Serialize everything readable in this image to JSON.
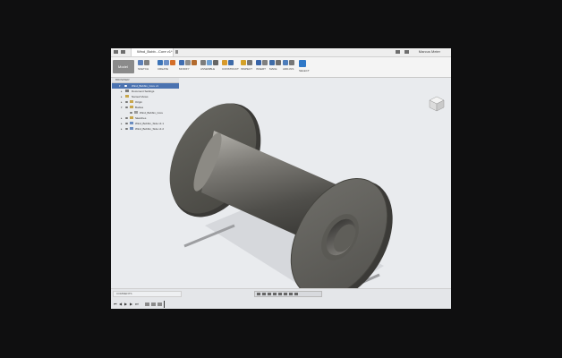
{
  "window": {
    "tab_title": "Wind_Bobb...Core v1*",
    "user_name": "Marcus Meier"
  },
  "toolbar": {
    "mode": "Model",
    "groups": [
      {
        "label": "SKETCH",
        "colors": [
          "#5b7fb8",
          "#5b7fb8",
          "#7f7f7f"
        ]
      },
      {
        "label": "CREATE",
        "colors": [
          "#3c74b8",
          "#6b8fc6",
          "#d46f2a"
        ]
      },
      {
        "label": "MODIFY",
        "colors": [
          "#3f6db1",
          "#8d8d8d",
          "#b36b2e"
        ]
      },
      {
        "label": "ASSEMBLE",
        "colors": [
          "#7d7d7d",
          "#6fa0d1",
          "#666666"
        ]
      },
      {
        "label": "CONSTRUCT",
        "colors": [
          "#d89a2b",
          "#3d6aa8"
        ]
      },
      {
        "label": "INSPECT",
        "colors": [
          "#d4a128",
          "#767676"
        ]
      },
      {
        "label": "INSERT",
        "colors": [
          "#3864a8",
          "#808080"
        ]
      },
      {
        "label": "MAKE",
        "colors": [
          "#3f6ca8",
          "#6e6e6e"
        ]
      },
      {
        "label": "ADD-INS",
        "colors": [
          "#4d7dbb",
          "#777777"
        ]
      },
      {
        "label": "SELECT",
        "colors": [
          "#2f78c8"
        ]
      }
    ]
  },
  "browser": {
    "header": "BROWSER",
    "items": [
      {
        "label": "Wind_Bobbin_Core v1",
        "root": true
      },
      {
        "label": "Document Settings",
        "root": false
      },
      {
        "label": "Named Views",
        "root": false
      },
      {
        "label": "Origin",
        "root": false
      },
      {
        "label": "Bodies",
        "root": false
      },
      {
        "label": "Wind_Bobbin_Core",
        "root": false
      },
      {
        "label": "Sketches",
        "root": false
      },
      {
        "label": "Wind_Bobbin_Side v1:1",
        "root": false
      },
      {
        "label": "Wind_Bobbin_Side v1:2",
        "root": false
      }
    ]
  },
  "bottom": {
    "comments_label": "COMMENTS"
  },
  "colors": {
    "background": "#0f0f10",
    "viewport": "#e9ebee",
    "selection": "#4a72b0"
  }
}
